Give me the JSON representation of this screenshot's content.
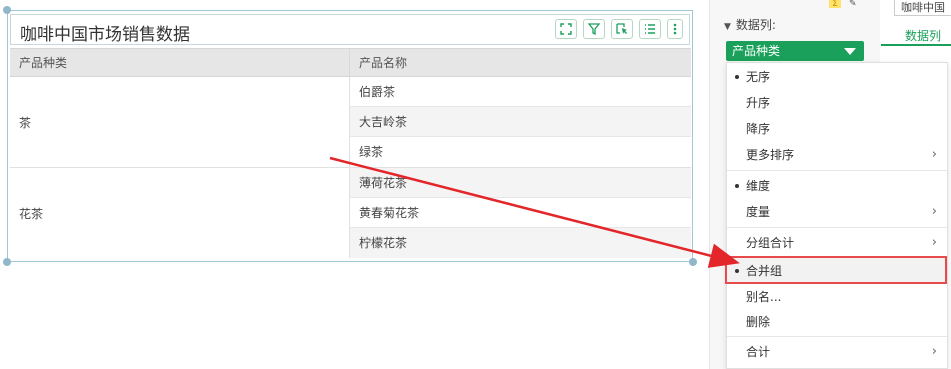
{
  "widget": {
    "title": "咖啡中国市场销售数据",
    "columns": [
      "产品种类",
      "产品名称"
    ],
    "groups": [
      {
        "category": "茶",
        "products": [
          "伯爵茶",
          "大吉岭茶",
          "绿茶"
        ]
      },
      {
        "category": "花茶",
        "products": [
          "薄荷花茶",
          "黄春菊花茶",
          "柠檬花茶"
        ]
      }
    ],
    "tool_icons": [
      "expand-icon",
      "filter-icon",
      "select-icon",
      "list-icon",
      "more-icon"
    ]
  },
  "panel": {
    "section_label": "数据列:",
    "field_pill": "产品种类",
    "far_input": "咖啡中国",
    "far_tab": "数据列"
  },
  "menu": {
    "items": [
      {
        "label": "无序",
        "dot": true,
        "submenu": false
      },
      {
        "label": "升序",
        "dot": false,
        "submenu": false
      },
      {
        "label": "降序",
        "dot": false,
        "submenu": false
      },
      {
        "label": "更多排序",
        "dot": false,
        "submenu": true
      },
      {
        "label": "维度",
        "dot": true,
        "submenu": false
      },
      {
        "label": "度量",
        "dot": false,
        "submenu": true
      },
      {
        "label": "分组合计",
        "dot": false,
        "submenu": true
      },
      {
        "label": "合并组",
        "dot": true,
        "submenu": false
      },
      {
        "label": "别名...",
        "dot": false,
        "submenu": false
      },
      {
        "label": "删除",
        "dot": false,
        "submenu": false
      },
      {
        "label": "合计",
        "dot": false,
        "submenu": true
      }
    ]
  },
  "colors": {
    "accent": "#1aa05a",
    "highlight": "#e8494b"
  }
}
